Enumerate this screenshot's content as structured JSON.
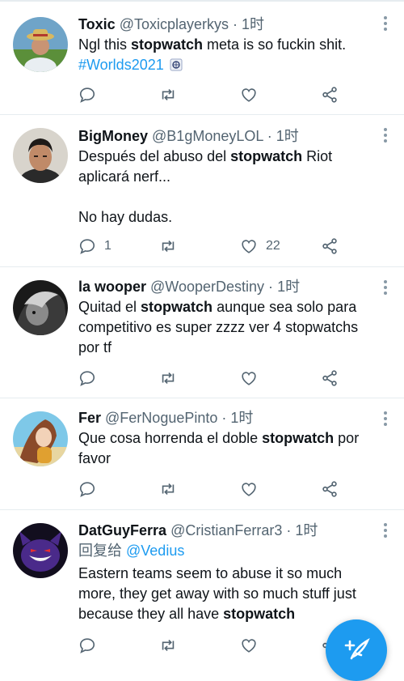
{
  "tweets": [
    {
      "name": "Toxic",
      "handle": "@Toxicplayerkys",
      "dot": "·",
      "time": "1时",
      "text_before": "Ngl this ",
      "text_bold": "stopwatch",
      "text_after": " meta is so fuckin shit.",
      "hashtag": "#Worlds2021",
      "reply_count": "",
      "like_count": ""
    },
    {
      "name": "BigMoney",
      "handle": "@B1gMoneyLOL",
      "dot": "·",
      "time": "1时",
      "text_before": "Después del abuso del ",
      "text_bold": "stopwatch",
      "text_after": " Riot aplicará nerf...",
      "text_line2": "No hay dudas.",
      "reply_count": "1",
      "like_count": "22"
    },
    {
      "name": "la wooper",
      "handle": "@WooperDestiny",
      "dot": "·",
      "time": "1时",
      "text_before": "Quitad el ",
      "text_bold": "stopwatch",
      "text_after": " aunque sea solo para competitivo es super zzzz ver 4 stopwatchs por tf",
      "reply_count": "",
      "like_count": ""
    },
    {
      "name": "Fer",
      "handle": "@FerNoguePinto",
      "dot": "·",
      "time": "1时",
      "text_before": "Que cosa horrenda el doble ",
      "text_bold": "stopwatch",
      "text_after": " por favor",
      "reply_count": "",
      "like_count": ""
    },
    {
      "name": "DatGuyFerra",
      "handle": "@CristianFerrar3",
      "dot": "·",
      "time": "1时",
      "reply_label": "回复给 ",
      "reply_mention": "@Vedius",
      "text_before": "Eastern teams seem to abuse it so much more, they get away with so much stuff just because they all have ",
      "text_bold": "stopwatch",
      "text_after": "",
      "reply_count": "",
      "like_count": ""
    }
  ],
  "colors": {
    "accent": "#1d9bf0",
    "secondary_text": "#536471",
    "divider": "#e6ecf0"
  },
  "icons": [
    "reply-icon",
    "retweet-icon",
    "like-icon",
    "share-icon",
    "more-options-icon",
    "compose-tweet-icon",
    "worlds-emoji-icon"
  ]
}
